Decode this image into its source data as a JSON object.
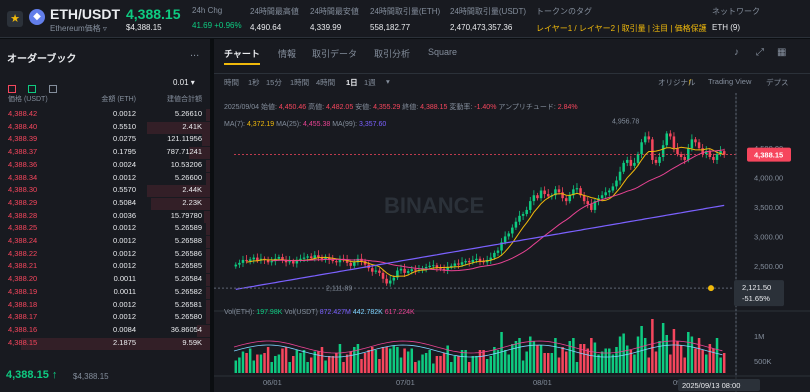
{
  "header": {
    "symbol": "ETH/USDT",
    "subtitle": "Ethereum価格 ▿",
    "last_price": "4,388.15",
    "last_price_usd": "$4,388.15",
    "stats": [
      {
        "label": "24h Chg",
        "value": "41.69 +0.96%",
        "color": "green"
      },
      {
        "label": "24時間最高値",
        "value": "4,490.64"
      },
      {
        "label": "24時間最安値",
        "value": "4,339.99"
      },
      {
        "label": "24時間取引量(ETH)",
        "value": "558,182.77"
      },
      {
        "label": "24時間取引量(USDT)",
        "value": "2,470,473,357.36"
      },
      {
        "label": "トークンのタグ",
        "value": "レイヤー1 / レイヤー2 | 取引量 | 注目 | 価格保護",
        "color": "yellow"
      },
      {
        "label": "ネットワーク",
        "value": "ETH (9)"
      }
    ]
  },
  "orderbook": {
    "title": "オーダーブック",
    "more": "...",
    "tick": "0.01 ▾",
    "headers": [
      "価格 (USDT)",
      "金額 (ETH)",
      "建値合計額"
    ],
    "rows": [
      [
        "4,388.42",
        "0.0012",
        "5.26610"
      ],
      [
        "4,388.40",
        "0.5510",
        "2.41K"
      ],
      [
        "4,388.39",
        "0.0275",
        "121.11956"
      ],
      [
        "4,388.37",
        "0.1795",
        "787.71241"
      ],
      [
        "4,388.36",
        "0.0024",
        "10.53206"
      ],
      [
        "4,388.34",
        "0.0012",
        "5.26600"
      ],
      [
        "4,388.30",
        "0.5570",
        "2.44K"
      ],
      [
        "4,388.29",
        "0.5084",
        "2.23K"
      ],
      [
        "4,388.28",
        "0.0036",
        "15.79780"
      ],
      [
        "4,388.25",
        "0.0012",
        "5.26589"
      ],
      [
        "4,388.24",
        "0.0012",
        "5.26588"
      ],
      [
        "4,388.22",
        "0.0012",
        "5.26586"
      ],
      [
        "4,388.21",
        "0.0012",
        "5.26585"
      ],
      [
        "4,388.20",
        "0.0011",
        "5.26584"
      ],
      [
        "4,388.19",
        "0.0011",
        "5.26582"
      ],
      [
        "4,388.18",
        "0.0012",
        "5.26581"
      ],
      [
        "4,388.17",
        "0.0012",
        "5.26580"
      ],
      [
        "4,388.16",
        "0.0084",
        "36.86054"
      ],
      [
        "4,388.15",
        "2.1875",
        "9.59K"
      ]
    ],
    "mid_price": "4,388.15 ↑",
    "mid_usd": "$4,388.15"
  },
  "chart_panel": {
    "tabs": [
      "チャート",
      "情報",
      "取引データ",
      "取引分析",
      "Square"
    ],
    "intervals": [
      "時間",
      "1秒",
      "15分",
      "1時間",
      "4時間",
      "1日",
      "1週",
      "▾"
    ],
    "active_interval": "1日",
    "views": [
      "オリジナル",
      "Trading View",
      "デプス"
    ],
    "ohlc_line": [
      "2025/09/04",
      "始値:",
      "4,450.46",
      "高値:",
      "4,482.05",
      "安値:",
      "4,355.29",
      "終値:",
      "4,388.15",
      "変動率:",
      "-1.40%",
      "アンプリチュード:",
      "2.84%"
    ],
    "ma_line": [
      "MA(7):",
      "4,372.19",
      "MA(25):",
      "4,455.38",
      "MA(99):",
      "3,357.60"
    ],
    "vol_line": [
      "Vol(ETH):",
      "197.98K",
      "Vol(USDT)",
      "872.427M",
      "442.782K",
      "617.224K"
    ],
    "watermark": "BINANCE",
    "current_price_tag": "4,388.15",
    "crosshair_price": "2,121.50",
    "crosshair_pct": "-51.65%",
    "crosshair_date": "2025/09/13 08:00",
    "max_label": "4,956.78",
    "min_label": "2,111.89",
    "vol_axis": [
      "1M",
      "500K"
    ],
    "colors": {
      "up": "#0ecb81",
      "down": "#f6465d",
      "ma7": "#f0b90b",
      "ma25": "#e84393",
      "ma99": "#7b61ff",
      "accent": "#f0b90b"
    }
  },
  "chart_data": {
    "type": "candlestick",
    "x_ticks": [
      "06/01",
      "07/01",
      "08/01",
      "09/01"
    ],
    "y_ticks": [
      2500,
      3000,
      3500,
      4000,
      4500
    ],
    "ylim": [
      1800,
      5200
    ],
    "closes": [
      2520,
      2550,
      2600,
      2580,
      2610,
      2640,
      2590,
      2620,
      2600,
      2560,
      2580,
      2620,
      2650,
      2600,
      2560,
      2580,
      2540,
      2600,
      2620,
      2640,
      2660,
      2630,
      2680,
      2650,
      2610,
      2640,
      2600,
      2580,
      2560,
      2620,
      2600,
      2550,
      2500,
      2560,
      2620,
      2580,
      2520,
      2460,
      2400,
      2420,
      2380,
      2280,
      2200,
      2250,
      2300,
      2420,
      2450,
      2380,
      2410,
      2440,
      2420,
      2430,
      2460,
      2480,
      2500,
      2510,
      2470,
      2450,
      2430,
      2480,
      2500,
      2540,
      2520,
      2560,
      2580,
      2560,
      2600,
      2620,
      2580,
      2560,
      2600,
      2640,
      2720,
      2760,
      2900,
      3000,
      3050,
      3150,
      3250,
      3350,
      3380,
      3450,
      3600,
      3700,
      3650,
      3780,
      3720,
      3680,
      3700,
      3800,
      3750,
      3650,
      3600,
      3700,
      3800,
      3820,
      3700,
      3600,
      3550,
      3450,
      3600,
      3650,
      3700,
      3750,
      3780,
      3850,
      3950,
      4100,
      4250,
      4300,
      4200,
      4250,
      4400,
      4600,
      4700,
      4650,
      4300,
      4250,
      4350,
      4550,
      4750,
      4700,
      4500,
      4400,
      4350,
      4300,
      4500,
      4650,
      4600,
      4500,
      4400,
      4450,
      4350,
      4300,
      4400,
      4450,
      4390
    ],
    "series": [
      {
        "name": "MA(7)"
      },
      {
        "name": "MA(25)"
      },
      {
        "name": "MA(99)"
      }
    ]
  }
}
